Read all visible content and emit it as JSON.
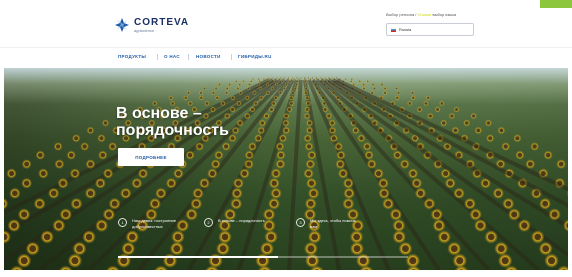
{
  "header": {
    "logo": {
      "name": "CORTEVA",
      "sub": "agriscience",
      "icon": "corteva-logo-icon",
      "colors": {
        "blue": "#1e5aa8",
        "light": "#7fb0e0"
      }
    },
    "region": {
      "prompt": "Выбор региона / ",
      "prompt_accent": "Choose",
      "prompt_tail": " выбор языка",
      "selected": "Russia",
      "flag_icon": "russia-flag-icon"
    }
  },
  "nav": {
    "items": [
      {
        "label": "ПРОДУКТЫ"
      },
      {
        "label": "О НАС"
      },
      {
        "label": "НОВОСТИ"
      },
      {
        "label": "ГИБРИДЫ.RU"
      }
    ]
  },
  "hero": {
    "headline_line1": "В основе –",
    "headline_line2": "порядочность",
    "cta_label": "ПОДРОБНЕЕ",
    "slides": [
      {
        "number": "1",
        "text": "Наш девиз: построение добросовестных"
      },
      {
        "number": "2",
        "text": "В основе – порядочность"
      },
      {
        "number": "3",
        "text": "Мы здесь, чтобы помочь вам"
      }
    ],
    "progress": 0.55
  },
  "colors": {
    "brand_blue": "#1b2f63",
    "link_blue": "#1e5aa8",
    "accent_green": "#8cc63f",
    "accent_yellow": "#c7d900"
  }
}
